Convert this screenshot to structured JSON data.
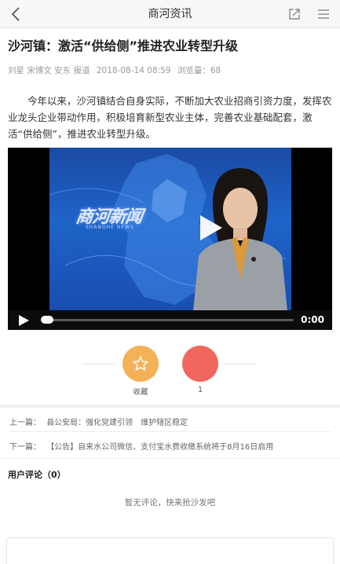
{
  "header": {
    "title": "商河资讯",
    "back_icon": "chevron-left-icon",
    "share_icon": "share-icon",
    "menu_icon": "menu-icon"
  },
  "article": {
    "title": "沙河镇：激活“供给侧”推进农业转型升级",
    "meta": {
      "authors": "刘星 宋博文 安东 报道",
      "datetime": "2018-08-14 08:59",
      "views_label": "浏览量：",
      "views": "68"
    },
    "body": "今年以来，沙河镇结合自身实际，不断加大农业招商引资力度，发挥农业龙头企业带动作用，积极培育新型农业主体，完善农业基础配套，激活“供给侧”，推进农业转型升级。"
  },
  "video": {
    "logo_text": "商河新闻",
    "logo_sub": "SHANGHE NEWS",
    "time": "0:00",
    "progress": 0
  },
  "actions": {
    "favorite_label": "收藏",
    "like_count": "1",
    "colors": {
      "favorite": "#f5b158",
      "like": "#f0675f"
    }
  },
  "navigation": {
    "prev_label": "上一篇：",
    "prev_title": "县公安局：强化党建引领　维护辖区稳定",
    "next_label": "下一篇：",
    "next_title": "【公告】自来水公司微信、支付宝水费收缴系统将于8月16日启用"
  },
  "comments": {
    "title": "用户评论（0）",
    "empty_text": "暂无评论，快来抢沙发吧"
  }
}
